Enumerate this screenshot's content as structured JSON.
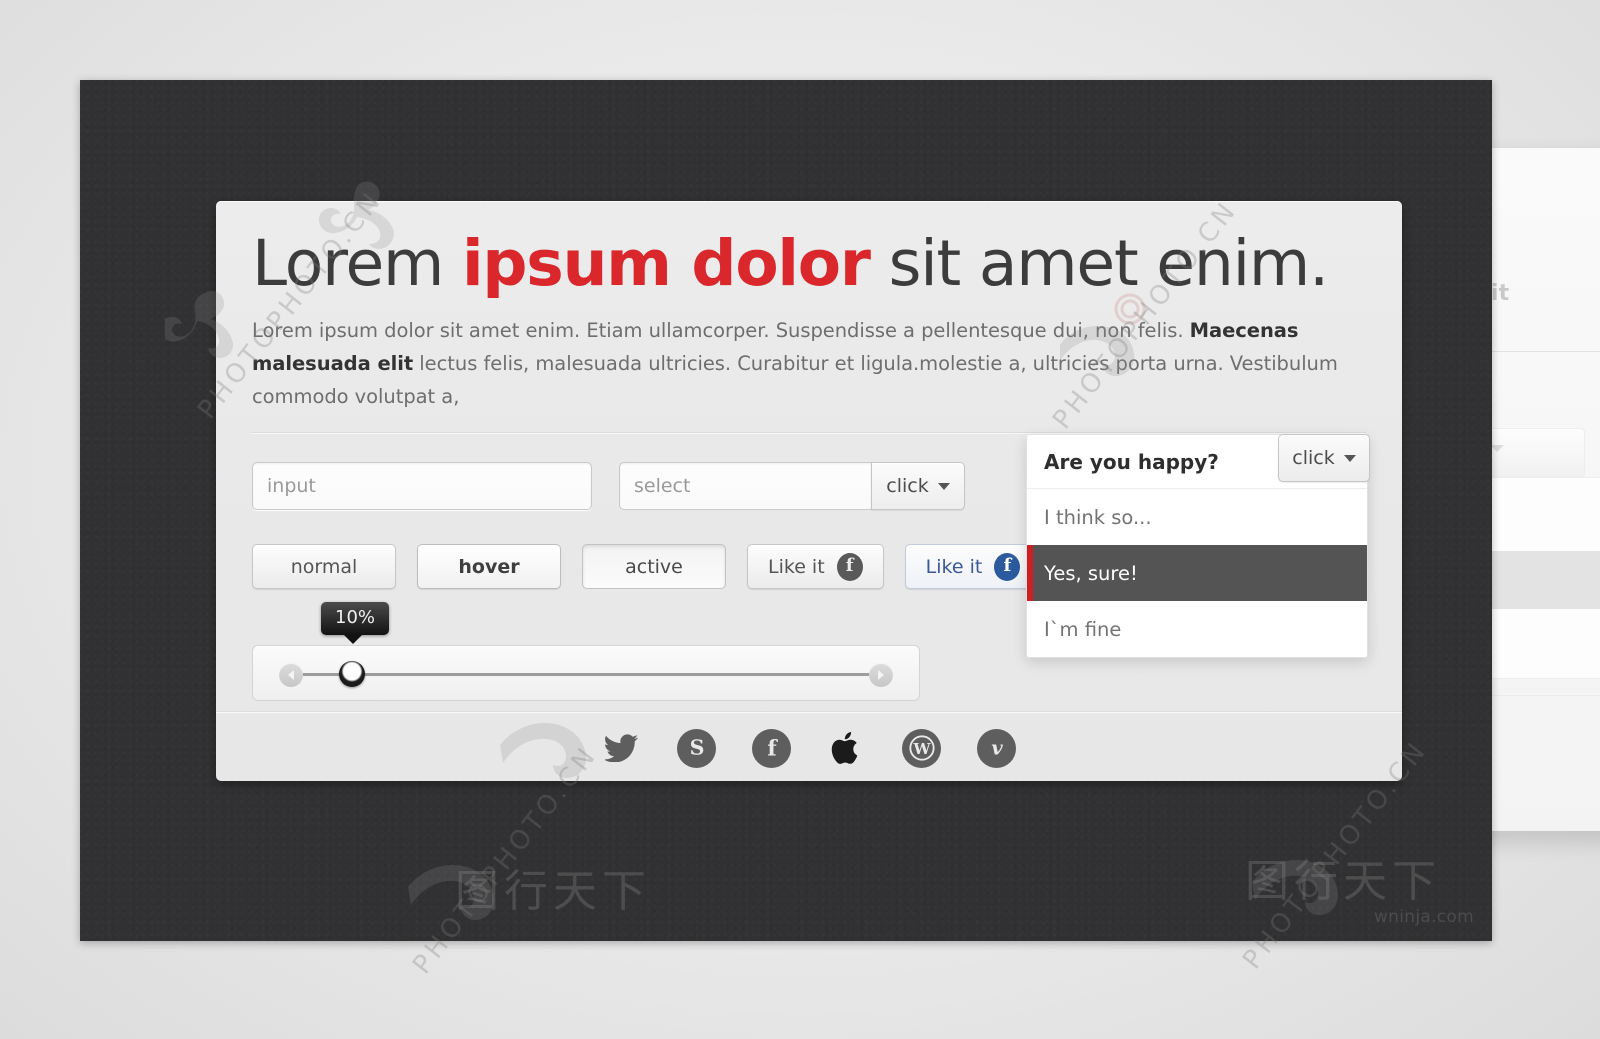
{
  "stage": {
    "credit": "wninja.com"
  },
  "card": {
    "headline": {
      "before": "Lorem ",
      "accent": "ipsum dolor",
      "after": " sit amet enim."
    },
    "lede": {
      "part1": "Lorem ipsum dolor sit amet enim. Etiam ullamcorper. Suspendisse a pellentesque dui, non felis. ",
      "bold": "Maecenas malesuada elit",
      "part2": " lectus felis, malesuada ultricies. Curabitur et ligula.molestie a, ultricies porta urna. Vestibulum commodo volutpat a,"
    }
  },
  "fields": {
    "input_placeholder": "input",
    "input_value": "",
    "select_value": "select",
    "select_trigger_label": "click"
  },
  "buttons": [
    {
      "label": "normal",
      "state": "normal"
    },
    {
      "label": "hover",
      "state": "hover"
    },
    {
      "label": "active",
      "state": "active"
    },
    {
      "label": "Like it",
      "state": "like-gray"
    },
    {
      "label": "Like it",
      "state": "like-blue"
    }
  ],
  "slider": {
    "tooltip_value": "10%",
    "percent": 10,
    "left_arrow": "arrow-left-icon",
    "right_arrow": "arrow-right-icon"
  },
  "dropdown": {
    "header": "Are you happy?",
    "trigger_label": "click",
    "items": [
      {
        "label": "I think so...",
        "selected": false
      },
      {
        "label": "Yes, sure!",
        "selected": true
      },
      {
        "label": "I`m fine",
        "selected": false
      }
    ],
    "selected_accent": "#cc2024",
    "selected_bg": "#545454"
  },
  "social": [
    {
      "name": "twitter-icon",
      "glyph": "twitter"
    },
    {
      "name": "skype-icon",
      "glyph": "skype"
    },
    {
      "name": "facebook-icon",
      "glyph": "facebook"
    },
    {
      "name": "apple-icon",
      "glyph": "apple"
    },
    {
      "name": "wordpress-icon",
      "glyph": "wordpress"
    },
    {
      "name": "vimeo-icon",
      "glyph": "vimeo"
    }
  ],
  "ghost": {
    "text": "elit"
  },
  "watermark": {
    "cn": "图行天下",
    "en": "PHOTOPHOTO.CN"
  },
  "colors": {
    "accent_red": "#d9272b",
    "stage_dark": "#313133",
    "card_bg": "#eaeaea",
    "facebook_blue": "#3b5998"
  }
}
